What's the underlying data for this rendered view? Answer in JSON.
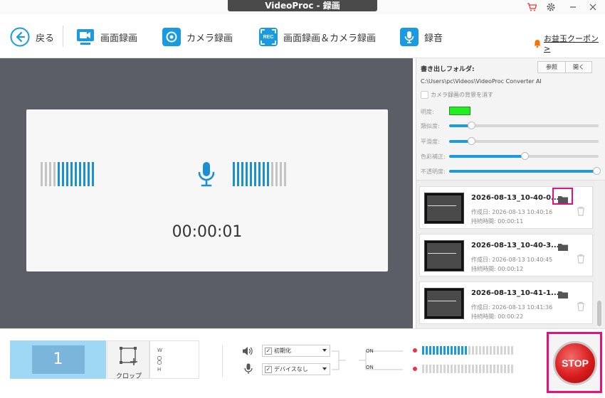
{
  "window": {
    "title": "VideoProc - 録画"
  },
  "toolbar": {
    "back_label": "戻る",
    "screen_label": "画面録画",
    "camera_label": "カメラ録画",
    "screen_camera_label": "画面録画＆カメラ録画",
    "audio_label": "録音",
    "rec_badge": "REC",
    "coupon_label": "お益玉クーポン>"
  },
  "preview": {
    "timer": "00:00:01",
    "level_bars_active": 9,
    "level_bars_total": 13
  },
  "settings": {
    "export_folder_label": "書き出しフォルダ:",
    "browse_label": "参照",
    "open_label": "開く",
    "path": "C:\\Users\\pc\\Videos\\VideoProc Converter AI",
    "remove_bg_label": "カメラ録画の背景を消す",
    "brightness_label": "明度:",
    "similarity_label": "類似度:",
    "smoothness_label": "平滑度:",
    "color_correction_label": "色彩補正:",
    "opacity_label": "不透明度:",
    "key_color": "#22ee22",
    "similarity": 0.16,
    "smoothness": 0.16,
    "color_correction": 0.5,
    "opacity": 1.0
  },
  "recordings": [
    {
      "name": "2026-08-13_10-40-0...",
      "created": "作成日: 2026-08-13 10:40:16",
      "duration": "持続時間: 00:00:11"
    },
    {
      "name": "2026-08-13_10-40-3...",
      "created": "作成日: 2026-08-13 10:40:45",
      "duration": "持続時間: 00:00:12"
    },
    {
      "name": "2026-08-13_10-41-1...",
      "created": "作成日: 2026-08-13 10:41:36",
      "duration": "持続時間: 00:00:22"
    }
  ],
  "bottom": {
    "monitor_number": "1",
    "crop_label": "クロップ",
    "w_label": "W",
    "h_label": "H",
    "speaker_select": "初期化",
    "mic_select": "デバイスなし",
    "speaker_on": "ON",
    "mic_on": "ON",
    "speaker_level_active": 13,
    "speaker_level_total": 26,
    "mic_level_active": 0,
    "mic_level_total": 26,
    "stop_label": "STOP"
  },
  "colors": {
    "accent": "#1a9ae0",
    "highlight": "#e5107a",
    "stop": "#d81c1c"
  }
}
